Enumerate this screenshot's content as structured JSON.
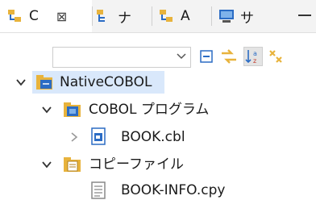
{
  "tabs": [
    {
      "label": "C",
      "close": "⊠",
      "icon": "package-explorer-icon"
    },
    {
      "label": "ナ",
      "icon": "navigator-icon"
    },
    {
      "label": "A",
      "icon": "hierarchy-icon"
    },
    {
      "label": "サ",
      "icon": "server-icon"
    }
  ],
  "toolbar": {
    "filter_value": "",
    "buttons": [
      "collapse-all-icon",
      "link-editor-icon",
      "sort-az-icon",
      "view-menu-icon"
    ]
  },
  "tree": [
    {
      "label": "NativeCOBOL",
      "level": 0,
      "expanded": true,
      "selected": true,
      "icon": "cobol-project-icon"
    },
    {
      "label": "COBOL プログラム",
      "level": 1,
      "expanded": true,
      "icon": "source-folder-icon"
    },
    {
      "label": "BOOK.cbl",
      "level": 2,
      "expanded": false,
      "icon": "cobol-file-icon"
    },
    {
      "label": "コピーファイル",
      "level": 1,
      "expanded": true,
      "icon": "copybook-folder-icon"
    },
    {
      "label": "BOOK-INFO.cpy",
      "level": 2,
      "icon": "copybook-file-icon"
    }
  ],
  "colors": {
    "selection": "#d9e8fb",
    "folder": "#e8b33c",
    "accent": "#2b6cc4"
  }
}
